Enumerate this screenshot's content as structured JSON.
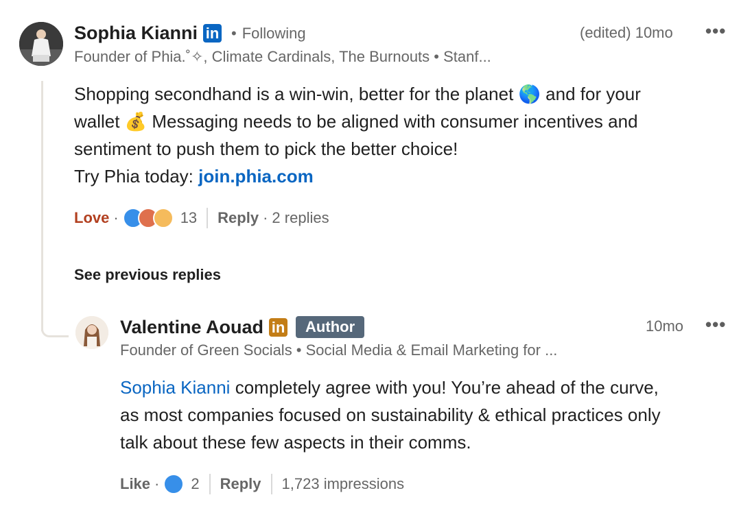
{
  "colors": {
    "link": "#0a66c2",
    "love": "#b24020",
    "author_badge": "#56687a",
    "muted": "#666666"
  },
  "comment": {
    "name": "Sophia Kianni",
    "separator": "•",
    "following": "Following",
    "edited_time": "(edited) 10mo",
    "headline": "Founder of Phia.˚✧, Climate Cardinals, The Burnouts • Stanf...",
    "text_line1": "Shopping secondhand is a win-win, better for the planet",
    "emoji_globe": "🌎",
    "text_line1b": "and for your",
    "text_line2a": "wallet",
    "emoji_money": "💰",
    "text_line2b": "Messaging needs to be aligned with consumer incentives and",
    "text_line3": "sentiment to push them to pick the better choice!",
    "text_line4": "Try Phia today:",
    "link_text": "join.phia.com",
    "reaction_label": "Love",
    "dot": "·",
    "reaction_count": "13",
    "reply_label": "Reply",
    "replies_count": "2 replies"
  },
  "see_previous": "See previous replies",
  "reply": {
    "name": "Valentine Aouad",
    "badge": "Author",
    "time": "10mo",
    "headline": "Founder of Green Socials • Social Media & Email Marketing for ...",
    "mention": "Sophia Kianni",
    "text_line1": "completely agree with you! You’re ahead of the curve,",
    "text_line2": "as most companies focused on sustainability & ethical practices only",
    "text_line3": "talk about these few aspects in their comms.",
    "like_label": "Like",
    "dot": "·",
    "reaction_count": "2",
    "reply_label": "Reply",
    "impressions": "1,723 impressions"
  },
  "icons": {
    "more": "more-options-icon",
    "linkedin": "linkedin-icon"
  }
}
